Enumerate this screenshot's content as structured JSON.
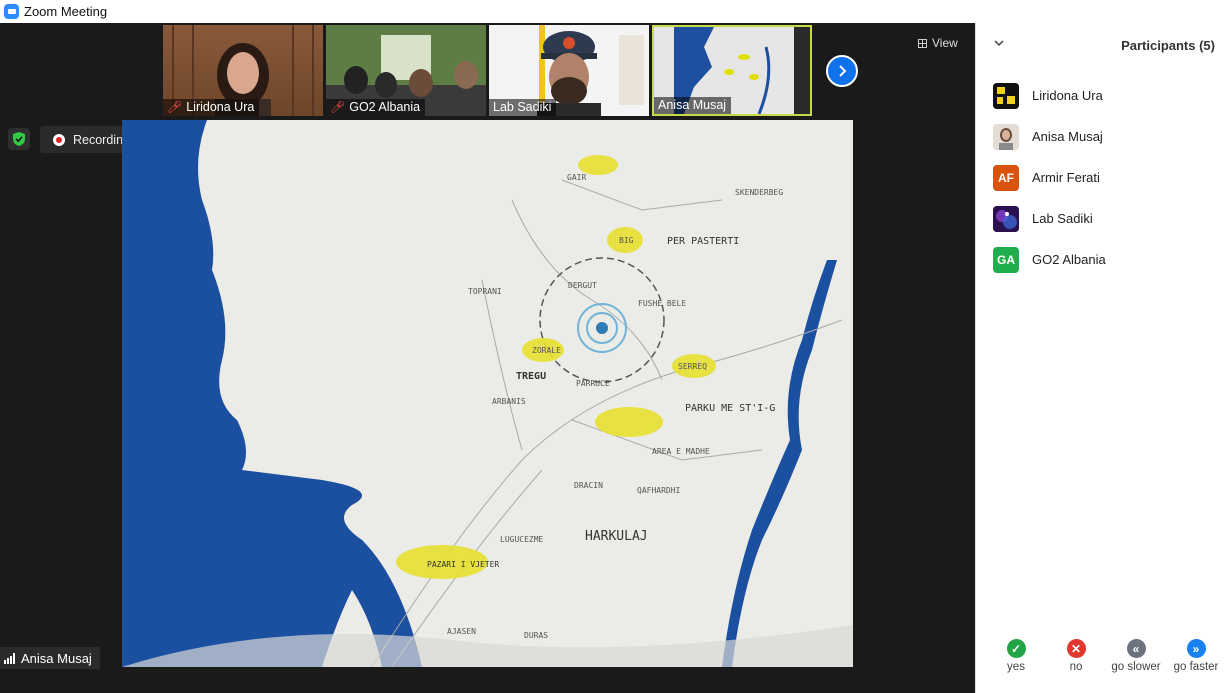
{
  "window": {
    "title": "Zoom Meeting"
  },
  "video_strip": [
    {
      "name": "Liridona Ura",
      "muted": true
    },
    {
      "name": "GO2 Albania",
      "muted": true
    },
    {
      "name": "Lab Sadiki",
      "muted": false
    },
    {
      "name": "Anisa Musaj",
      "muted": false
    }
  ],
  "toolbar": {
    "view_label": "View"
  },
  "recording": {
    "label": "Recording..."
  },
  "active_speaker": {
    "name": "Anisa Musaj"
  },
  "shared_map": {
    "labels": [
      "SKENDERBEG",
      "BIG",
      "PER PASTERTI",
      "DERGUT",
      "FUSHE BELE",
      "ZORALE",
      "TREGU",
      "SERREQ",
      "PARRUCE",
      "PARKU ME ST'I-G",
      "AREA E MADHE",
      "DRACIN",
      "QAFHARDHI",
      "HARKULAJ",
      "PAZARI I VJETER",
      "LUGUCEZME",
      "GAIR",
      "AJASEN",
      "DURAS",
      "TOPRANI",
      "ARBANIS"
    ]
  },
  "participants_panel": {
    "title": "Participants (5)",
    "participants": [
      {
        "name": "Liridona Ura",
        "initials": "",
        "color": "#111111"
      },
      {
        "name": "Anisa Musaj",
        "initials": "",
        "color": "#d9d2c9"
      },
      {
        "name": "Armir Ferati",
        "initials": "AF",
        "color": "#d9530d"
      },
      {
        "name": "Lab Sadiki",
        "initials": "",
        "color": "#3a1f6b"
      },
      {
        "name": "GO2 Albania",
        "initials": "GA",
        "color": "#1fae4b"
      }
    ]
  },
  "feedback": {
    "yes": "yes",
    "no": "no",
    "slower": "go slower",
    "faster": "go faster"
  }
}
